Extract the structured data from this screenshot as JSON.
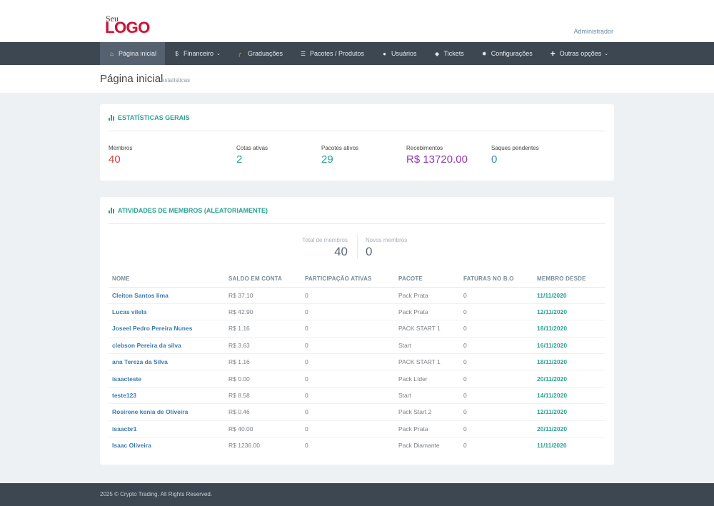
{
  "header": {
    "logo_small": "Seu",
    "logo_big": "LOGO",
    "user_label": "Administrador"
  },
  "nav": [
    {
      "icon": "home-icon",
      "glyph": "⌂",
      "label": "Página inicial",
      "active": true,
      "dropdown": false
    },
    {
      "icon": "dollar-icon",
      "glyph": "$",
      "label": "Financeiro",
      "active": false,
      "dropdown": true
    },
    {
      "icon": "graduation-cap-icon",
      "glyph": "🎓",
      "label": "Graduações",
      "active": false,
      "dropdown": false
    },
    {
      "icon": "list-icon",
      "glyph": "☰",
      "label": "Pacotes / Produtos",
      "active": false,
      "dropdown": false
    },
    {
      "icon": "user-icon",
      "glyph": "●",
      "label": "Usuários",
      "active": false,
      "dropdown": false
    },
    {
      "icon": "ticket-icon",
      "glyph": "◆",
      "label": "Tickets",
      "active": false,
      "dropdown": false
    },
    {
      "icon": "gear-icon",
      "glyph": "✹",
      "label": "Configurações",
      "active": false,
      "dropdown": false
    },
    {
      "icon": "plus-icon",
      "glyph": "✚",
      "label": "Outras opções",
      "active": false,
      "dropdown": true
    }
  ],
  "page": {
    "title": "Página inicial",
    "subtitle": "estatísticas"
  },
  "stats": {
    "title": "ESTATÍSTICAS GERAIS",
    "items": [
      {
        "label": "Membros",
        "value": "40",
        "color": "#d9433a"
      },
      {
        "label": "Cotas ativas",
        "value": "2",
        "color": "#2aa491"
      },
      {
        "label": "Pacotes ativos",
        "value": "29",
        "color": "#2aa491"
      },
      {
        "label": "Recebimentos",
        "value": "R$ 13720.00",
        "color": "#8e3bb0"
      },
      {
        "label": "Saques pendentes",
        "value": "0",
        "color": "#3c86c4"
      }
    ]
  },
  "activities": {
    "title": "ATIVIDADES DE MEMBROS (ALEATORIAMENTE)",
    "total_label": "Total de membros",
    "total_value": "40",
    "new_label": "Novos membros",
    "new_value": "0",
    "columns": [
      "NOME",
      "SALDO EM CONTA",
      "PARTICIPAÇÃO ATIVAS",
      "PACOTE",
      "FATURAS NO B.O",
      "MEMBRO DESDE"
    ],
    "rows": [
      [
        "Cleiton Santos lima",
        "R$ 37.10",
        "0",
        "Pack Prata",
        "0",
        "11/11/2020"
      ],
      [
        "Lucas vilela",
        "R$ 42.90",
        "0",
        "Pack Prata",
        "0",
        "12/11/2020"
      ],
      [
        "Joseel Pedro Pereira Nunes",
        "R$ 1.16",
        "0",
        "PACK START 1",
        "0",
        "18/11/2020"
      ],
      [
        "clebson Pereira da silva",
        "R$ 3.63",
        "0",
        "Start",
        "0",
        "16/11/2020"
      ],
      [
        "ana Tereza da Silva",
        "R$ 1.16",
        "0",
        "PACK START 1",
        "0",
        "18/11/2020"
      ],
      [
        "isaacteste",
        "R$ 0.00",
        "0",
        "Pack Líder",
        "0",
        "20/11/2020"
      ],
      [
        "teste123",
        "R$ 8.58",
        "0",
        "Start",
        "0",
        "14/11/2020"
      ],
      [
        "Rosirene kenia de Oliveira",
        "R$ 0.46",
        "0",
        "Pack Start 2",
        "0",
        "12/11/2020"
      ],
      [
        "isaacbr1",
        "R$ 40.00",
        "0",
        "Pack Prata",
        "0",
        "20/11/2020"
      ],
      [
        "Isaac Oliveira",
        "R$ 1236.00",
        "0",
        "Pack Diamante",
        "0",
        "11/11/2020"
      ]
    ]
  },
  "footer": {
    "text": "2025 © Crypto Trading. All Rights Reserved."
  }
}
